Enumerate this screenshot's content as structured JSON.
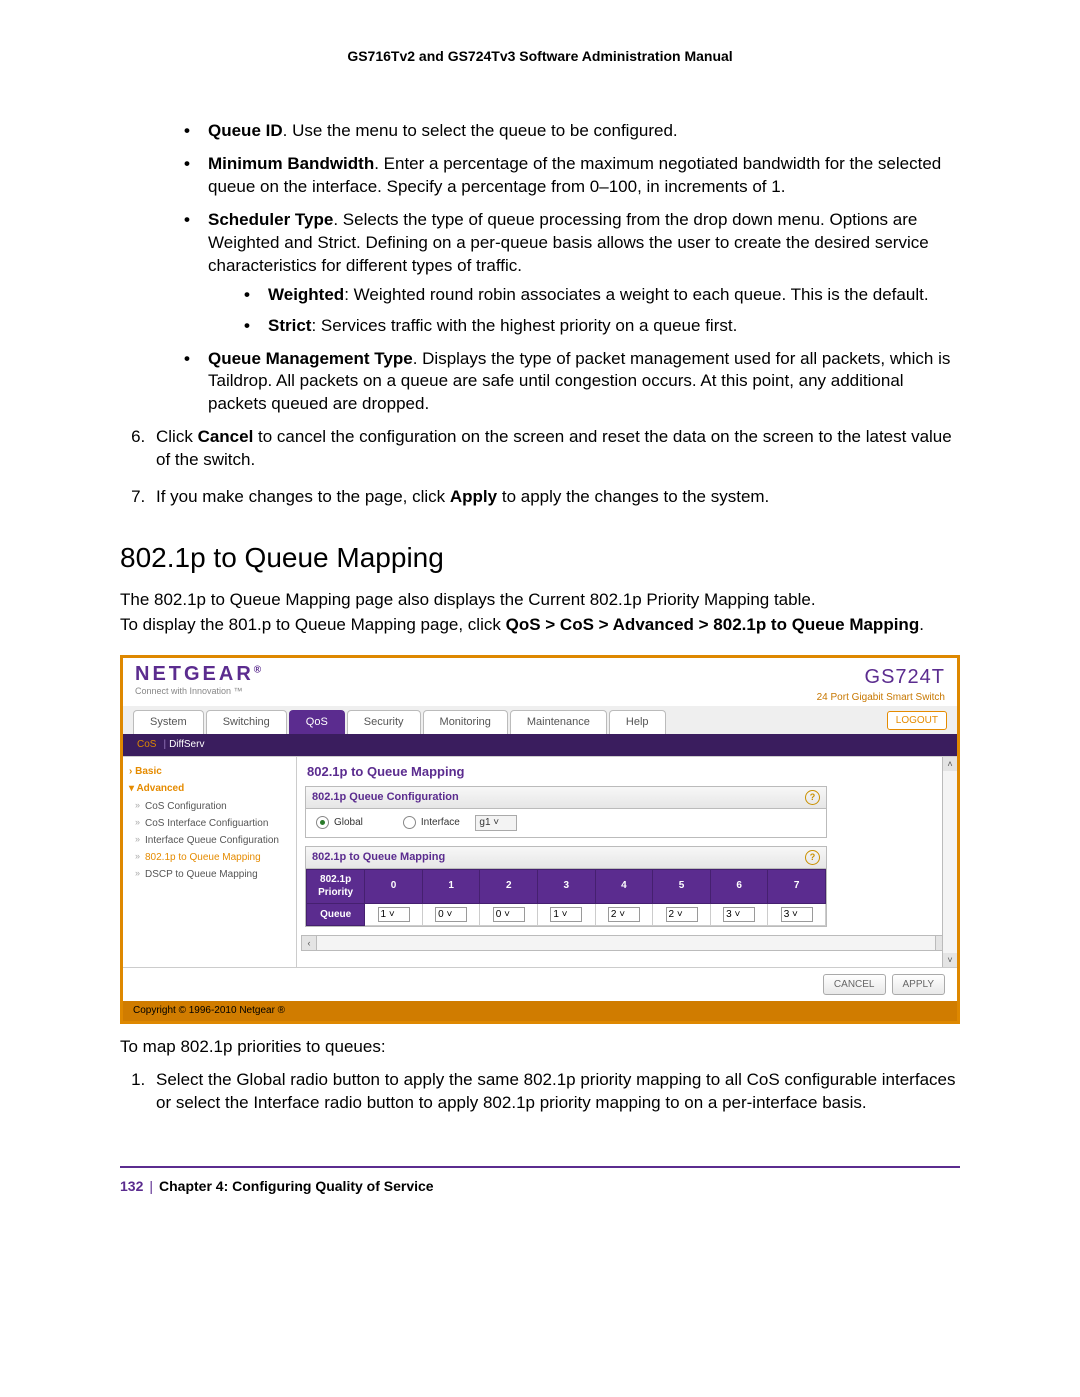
{
  "header": "GS716Tv2 and GS724Tv3 Software Administration Manual",
  "bullets": [
    {
      "term": "Queue ID",
      "text": ". Use the menu to select the queue to be configured."
    },
    {
      "term": "Minimum Bandwidth",
      "text": ". Enter a percentage of the maximum negotiated bandwidth for the selected queue on the interface. Specify a percentage from 0–100, in increments of 1."
    },
    {
      "term": "Scheduler Type",
      "text": ". Selects the type of queue processing from the drop down menu. Options are Weighted and Strict. Defining on a per-queue basis allows the user to create the desired service characteristics for different types of traffic.",
      "sub": [
        {
          "term": "Weighted",
          "text": ": Weighted round robin associates a weight to each queue. This is the default."
        },
        {
          "term": "Strict",
          "text": ": Services traffic with the highest priority on a queue first."
        }
      ]
    },
    {
      "term": "Queue Management Type",
      "text": ". Displays the type of packet management used for all packets, which is Taildrop. All packets on a queue are safe until congestion occurs. At this point, any additional packets queued are dropped."
    }
  ],
  "step6": {
    "pre": "Click ",
    "b": "Cancel",
    "post": " to cancel the configuration on the screen and reset the data on the screen to the latest value of the switch."
  },
  "step7": {
    "pre": "If you make changes to the page, click ",
    "b": "Apply",
    "post": " to apply the changes to the system."
  },
  "section_title": "802.1p to Queue Mapping",
  "section_p1": "The 802.1p to Queue Mapping page also displays the Current 802.1p Priority Mapping table.",
  "section_p2": {
    "pre": "To display the 801.p to Queue Mapping page, click ",
    "path": "QoS > CoS > Advanced > 802.1p to Queue Mapping",
    "post": "."
  },
  "ui": {
    "brand": "NETGEAR",
    "brand_tag": "Connect with Innovation ™",
    "model": "GS724T",
    "model_sub": "24 Port Gigabit Smart Switch",
    "tabs": [
      "System",
      "Switching",
      "QoS",
      "Security",
      "Monitoring",
      "Maintenance",
      "Help"
    ],
    "active_tab": "QoS",
    "subtabs": [
      "CoS",
      "DiffServ"
    ],
    "active_subtab": "CoS",
    "logout": "LOGOUT",
    "nav": {
      "basic": "Basic",
      "advanced": "Advanced",
      "items": [
        {
          "label": "CoS Configuration"
        },
        {
          "label": "CoS Interface Configuartion"
        },
        {
          "label": "Interface Queue Configuration"
        },
        {
          "label": "802.1p to Queue Mapping",
          "active": true
        },
        {
          "label": "DSCP to Queue Mapping"
        }
      ]
    },
    "page_title": "802.1p to Queue Mapping",
    "panel1": {
      "title": "802.1p Queue Configuration",
      "global": "Global",
      "interface": "Interface",
      "if_value": "g1"
    },
    "panel2": {
      "title": "802.1p to Queue Mapping",
      "row_priority": "802.1p Priority",
      "row_queue": "Queue",
      "priorities": [
        "0",
        "1",
        "2",
        "3",
        "4",
        "5",
        "6",
        "7"
      ],
      "queues": [
        "1",
        "0",
        "0",
        "1",
        "2",
        "2",
        "3",
        "3"
      ]
    },
    "buttons": {
      "cancel": "CANCEL",
      "apply": "APPLY"
    },
    "copyright": "Copyright © 1996-2010 Netgear ®"
  },
  "after_ui": "To map 802.1p priorities to queues:",
  "ol_after": [
    "Select the Global radio button to apply the same 802.1p priority mapping to all CoS configurable interfaces or select the Interface radio button to apply 802.1p priority mapping to on a per-interface basis."
  ],
  "footer": {
    "page": "132",
    "chapter": "Chapter 4:  Configuring Quality of Service"
  }
}
